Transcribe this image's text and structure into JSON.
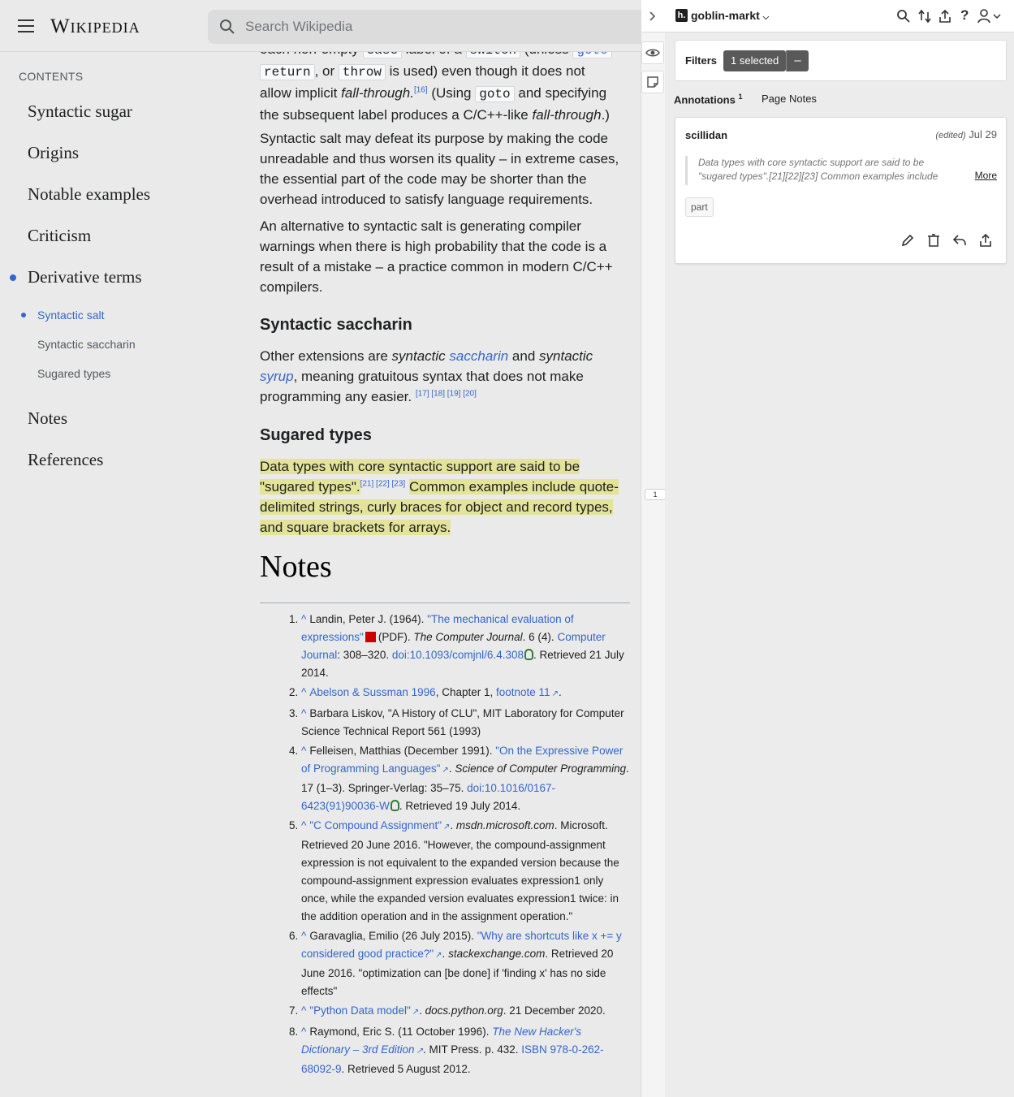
{
  "wiki": {
    "wordmark": "Wikipedia",
    "search_placeholder": "Search Wikipedia",
    "toc": {
      "heading": "CONTENTS",
      "items": [
        "Syntactic sugar",
        "Origins",
        "Notable examples",
        "Criticism",
        "Derivative terms"
      ],
      "subitems": [
        "Syntactic salt",
        "Syntactic saccharin",
        "Sugared types"
      ],
      "tail_items": [
        "Notes",
        "References"
      ]
    },
    "article": {
      "p1": {
        "l1a": "each non-empty",
        "l1b": "case",
        "l1c": "label of a",
        "l1d": "switch",
        "l1e": "(unless",
        "l1f": "goto",
        "l2a": "return",
        "l2b": ", or",
        "l2c": "throw",
        "l2d": "is used) even though it does not",
        "l3a": "allow implicit",
        "l3b": "fall-through.",
        "l3c": "[16]",
        "l3d": "(Using",
        "l3e": "goto",
        "l3f": "and specifying",
        "l4a": "the subsequent label produces a C/C++-like",
        "l4b": "fall-through",
        "l4c": ".)"
      },
      "p2": "Syntactic salt may defeat its purpose by making the code unreadable and thus worsen its quality – in extreme cases, the essential part of the code may be shorter than the overhead introduced to satisfy language requirements.",
      "p3": "An alternative to syntactic salt is generating compiler warnings when there is high probability that the code is a result of a mistake – a practice common in modern C/C++ compilers.",
      "h_saccharin": "Syntactic saccharin",
      "p4": {
        "a": "Other extensions are",
        "b": "syntactic",
        "c": "saccharin",
        "d": "and",
        "e": "syntactic",
        "f": "syrup",
        "g": ", meaning gratuitous syntax that does not make programming any easier.",
        "refs": "[17] [18] [19] [20]"
      },
      "h_sugared": "Sugared types",
      "p5": {
        "a": "Data types with core syntactic support are said to be \"sugared types\".",
        "refs": "[21] [22] [23]",
        "b": "Common examples include quote-delimited strings, curly braces for object and record types, and square brackets for arrays."
      },
      "h_notes": "Notes"
    },
    "notes": [
      {
        "n": "1.",
        "a": "Landin, Peter J. (1964).",
        "link1": "\"The mechanical evaluation of expressions\"",
        "b": "(PDF).",
        "i": "The Computer Journal",
        "c": ". 6 (4).",
        "link2": "Computer Journal",
        "d": ": 308–320.",
        "link3": "doi:10.1093/comjnl/6.4.308",
        "e": ". Retrieved 21 July 2014."
      },
      {
        "n": "2.",
        "link1": "Abelson & Sussman 1996",
        "a": ", Chapter 1,",
        "link2": "footnote 11",
        "b": "."
      },
      {
        "n": "3.",
        "a": "Barbara Liskov, \"A History of CLU\", MIT Laboratory for Computer Science Technical Report 561 (1993)"
      },
      {
        "n": "4.",
        "a": "Felleisen, Matthias (December 1991).",
        "link1": "\"On the Expressive Power of Programming Languages\"",
        "i": "Science of Computer Programming",
        "b": ". 17 (1–3). Springer-Verlag: 35–75.",
        "link2": "doi:10.1016/0167-6423(91)90036-W",
        "c": ". Retrieved 19 July 2014."
      },
      {
        "n": "5.",
        "link1": "\"C Compound Assignment\"",
        "i": "msdn.microsoft.com",
        "a": ". Microsoft. Retrieved 20 June 2016. \"However, the compound-assignment expression is not equivalent to the expanded version because the compound-assignment expression evaluates expression1 only once, while the expanded version evaluates expression1 twice: in the addition operation and in the assignment operation.\""
      },
      {
        "n": "6.",
        "a": "Garavaglia, Emilio (26 July 2015).",
        "link1": "\"Why are shortcuts like x += y considered good practice?\"",
        "i": "stackexchange.com",
        "b": ". Retrieved 20 June 2016. \"optimization can [be done] if 'finding x' has no side effects\""
      },
      {
        "n": "7.",
        "link1": "\"Python Data model\"",
        "i": "docs.python.org",
        "a": ". 21 December 2020."
      },
      {
        "n": "8.",
        "a": "Raymond, Eric S. (11 October 1996).",
        "link1": "The New Hacker's Dictionary – 3rd Edition",
        "b": ". MIT Press. p. 432.",
        "link2": "ISBN 978-0-262-68092-9",
        "c": ". Retrieved 5 August 2012."
      }
    ]
  },
  "hypothesis": {
    "group": "goblin-markt",
    "logo": "h.",
    "bucket_count": "1",
    "filters_label": "Filters",
    "filters_selected": "1 selected",
    "filters_clear": "–",
    "tabs": {
      "annotations": "Annotations",
      "annotations_count": "1",
      "page_notes": "Page Notes"
    },
    "annotation": {
      "user": "scillidan",
      "edited": "(edited)",
      "date": "Jul 29",
      "quote": "Data types with core syntactic support are said to be \"sugared types\".[21][22][23] Common examples include quote-delimited strings, curly braces for object and record types, and square brackets for arrays.",
      "more": "More",
      "tag": "part"
    },
    "colors": {
      "highlight": "#e3e49a",
      "link": "#3366cc"
    }
  }
}
